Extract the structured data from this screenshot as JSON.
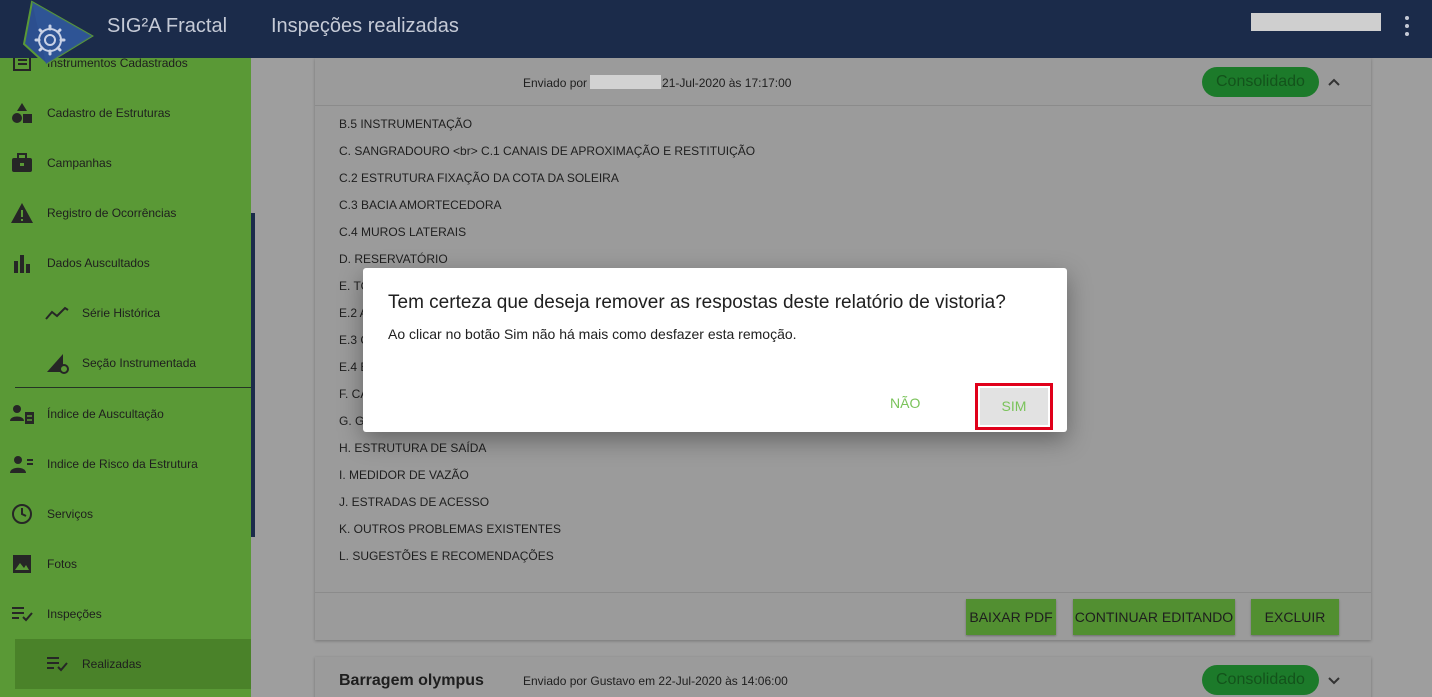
{
  "header": {
    "app_title": "SIG²A Fractal",
    "page_title": "Inspeções realizadas",
    "logo_icon": "gear-triangle-logo",
    "menu_icon": "kebab-menu-icon"
  },
  "sidebar": {
    "items": [
      {
        "label": "Instrumentos Cadastrados",
        "icon": "instrument-list-icon"
      },
      {
        "label": "Cadastro de Estruturas",
        "icon": "shapes-icon"
      },
      {
        "label": "Campanhas",
        "icon": "briefcase-icon"
      },
      {
        "label": "Registro de Ocorrências",
        "icon": "warning-icon"
      },
      {
        "label": "Dados Auscultados",
        "icon": "bar-chart-icon"
      },
      {
        "label": "Série Histórica",
        "icon": "trend-line-icon"
      },
      {
        "label": "Seção Instrumentada",
        "icon": "slope-gear-icon"
      },
      {
        "label": "Índice de Auscultação",
        "icon": "person-list-icon"
      },
      {
        "label": "Indice de Risco da Estrutura",
        "icon": "person-settings-icon"
      },
      {
        "label": "Serviços",
        "icon": "clock-icon"
      },
      {
        "label": "Fotos",
        "icon": "image-icon"
      },
      {
        "label": "Inspeções",
        "icon": "checklist-icon"
      },
      {
        "label": "Realizadas",
        "icon": "checklist-icon"
      }
    ]
  },
  "inspection": {
    "sent_by_prefix": "Enviado por",
    "sent_date": "21-Jul-2020 às 17:17:00",
    "status": "Consolidado",
    "items": [
      "B.5 INSTRUMENTAÇÃO",
      "C. SANGRADOURO <br> C.1 CANAIS DE APROXIMAÇÃO E RESTITUIÇÃO",
      "C.2 ESTRUTURA FIXAÇÃO DA COTA DA SOLEIRA",
      "C.3 BACIA AMORTECEDORA",
      "C.4 MUROS LATERAIS",
      "D. RESERVATÓRIO",
      "E. TO",
      "E.2 A",
      "E.3 C",
      "E.4 E",
      "F. CA",
      "G. G",
      "H. ESTRUTURA DE SAÍDA",
      "I. MEDIDOR DE VAZÃO",
      "J. ESTRADAS DE ACESSO",
      "K. OUTROS PROBLEMAS EXISTENTES",
      "L. SUGESTÕES E RECOMENDAÇÕES"
    ],
    "actions": {
      "pdf": "BAIXAR PDF",
      "edit": "CONTINUAR EDITANDO",
      "delete": "EXCLUIR"
    }
  },
  "inspection2": {
    "title": "Barragem olympus",
    "sent": "Enviado por Gustavo em 22-Jul-2020 às 14:06:00",
    "status": "Consolidado"
  },
  "dialog": {
    "title": "Tem certeza que deseja remover as respostas deste relatório de vistoria?",
    "body": "Ao clicar no botão Sim não há mais como desfazer esta remoção.",
    "no_label": "NÃO",
    "yes_label": "SIM"
  },
  "colors": {
    "topbar": "#1b2b4a",
    "sidebar": "#5a9936",
    "status_badge": "#1c7a2a",
    "action_button": "#528f31",
    "dialog_text_button": "#7ac35a",
    "highlight": "#e0001a"
  }
}
